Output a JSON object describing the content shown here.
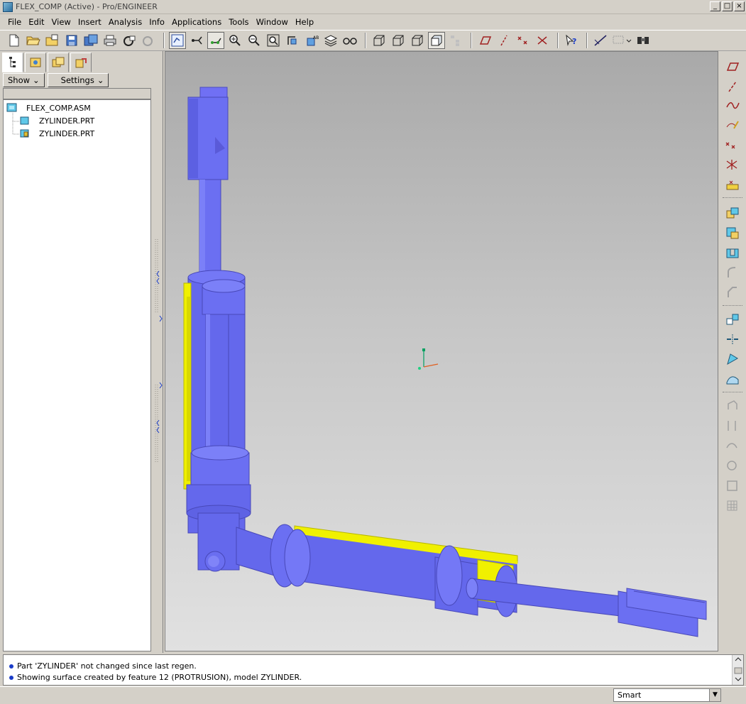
{
  "window": {
    "title": "FLEX_COMP (Active) - Pro/ENGINEER"
  },
  "menu": [
    "File",
    "Edit",
    "View",
    "Insert",
    "Analysis",
    "Info",
    "Applications",
    "Tools",
    "Window",
    "Help"
  ],
  "left_panel": {
    "show_label": "Show",
    "settings_label": "Settings",
    "tree": [
      {
        "label": "FLEX_COMP.ASM",
        "type": "assembly"
      },
      {
        "label": "ZYLINDER.PRT",
        "type": "part"
      },
      {
        "label": "ZYLINDER.PRT",
        "type": "part-active"
      }
    ]
  },
  "messages": [
    "Part 'ZYLINDER' not changed since last regen.",
    "Showing surface created by feature 12 (PROTRUSION), model ZYLINDER."
  ],
  "status": {
    "filter_value": "Smart"
  },
  "colors": {
    "model": "#6a6ef0",
    "section": "#f0f000",
    "accent": "#1a3cc8"
  }
}
